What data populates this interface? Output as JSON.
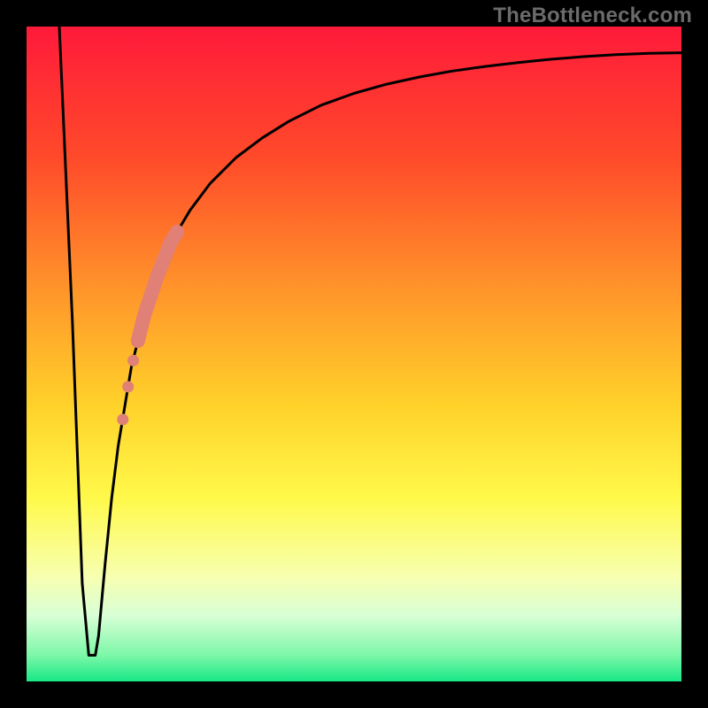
{
  "watermark": "TheBottleneck.com",
  "chart_data": {
    "type": "line",
    "title": "",
    "xlabel": "",
    "ylabel": "",
    "xlim": [
      0,
      100
    ],
    "ylim": [
      0,
      100
    ],
    "series": [
      {
        "name": "curve",
        "x": [
          5,
          7,
          8.5,
          9.5,
          10.5,
          11,
          12,
          13,
          14,
          16,
          18,
          20,
          22,
          25,
          28,
          32,
          36,
          40,
          45,
          50,
          55,
          60,
          65,
          70,
          75,
          80,
          85,
          90,
          95,
          100
        ],
        "y": [
          100,
          55,
          15,
          4,
          4,
          7,
          18,
          28,
          36,
          48,
          56,
          62,
          67,
          72,
          76,
          80,
          83,
          85.5,
          88,
          89.8,
          91.2,
          92.3,
          93.2,
          93.9,
          94.5,
          95,
          95.4,
          95.7,
          95.9,
          96
        ]
      }
    ],
    "highlight_segment": {
      "x_start": 17,
      "x_end": 23,
      "style": "thick-salmon"
    },
    "highlight_points": [
      {
        "x": 15.5,
        "y": 45
      },
      {
        "x": 16.3,
        "y": 49
      },
      {
        "x": 14.7,
        "y": 40
      }
    ],
    "background_gradient": {
      "stops": [
        {
          "pos": 0.0,
          "color": "#ff1a3a"
        },
        {
          "pos": 0.2,
          "color": "#ff4a2a"
        },
        {
          "pos": 0.4,
          "color": "#ff942a"
        },
        {
          "pos": 0.58,
          "color": "#ffd22a"
        },
        {
          "pos": 0.72,
          "color": "#fff94a"
        },
        {
          "pos": 0.84,
          "color": "#f7ffb0"
        },
        {
          "pos": 0.9,
          "color": "#d8ffd6"
        },
        {
          "pos": 0.96,
          "color": "#7cf7a8"
        },
        {
          "pos": 1.0,
          "color": "#17e887"
        }
      ]
    }
  }
}
